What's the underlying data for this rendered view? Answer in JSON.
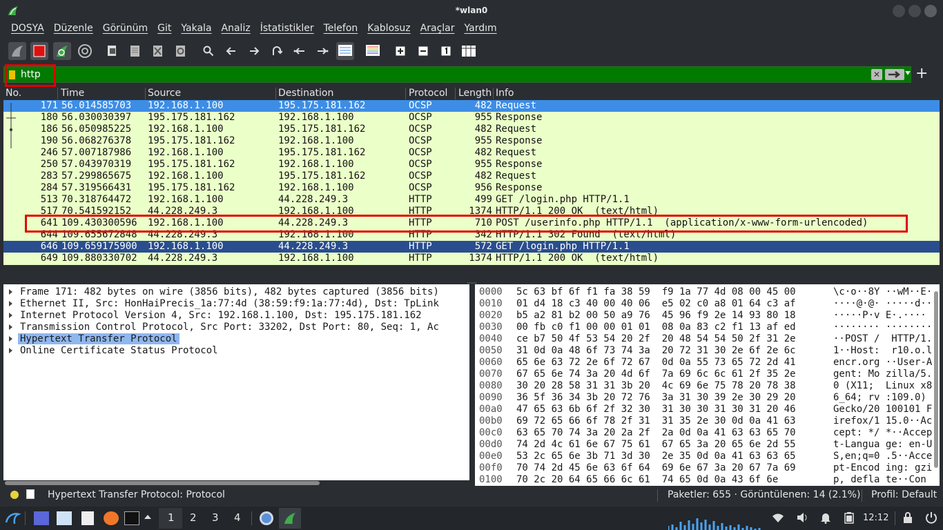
{
  "window": {
    "title": "*wlan0"
  },
  "menu": [
    "DOSYA",
    "Düzenle",
    "Görünüm",
    "Git",
    "Yakala",
    "Analiz",
    "İstatistikler",
    "Telefon",
    "Kablosuz",
    "Araçlar",
    "Yardım"
  ],
  "filter": {
    "value": "http"
  },
  "columns": [
    "No.",
    "Time",
    "Source",
    "Destination",
    "Protocol",
    "Length",
    "Info"
  ],
  "packets": [
    {
      "no": "171",
      "time": "56.014585703",
      "src": "192.168.1.100",
      "dst": "195.175.181.162",
      "proto": "OCSP",
      "len": "482",
      "info": "Request"
    },
    {
      "no": "180",
      "time": "56.030030397",
      "src": "195.175.181.162",
      "dst": "192.168.1.100",
      "proto": "OCSP",
      "len": "955",
      "info": "Response"
    },
    {
      "no": "186",
      "time": "56.050985225",
      "src": "192.168.1.100",
      "dst": "195.175.181.162",
      "proto": "OCSP",
      "len": "482",
      "info": "Request"
    },
    {
      "no": "190",
      "time": "56.068276378",
      "src": "195.175.181.162",
      "dst": "192.168.1.100",
      "proto": "OCSP",
      "len": "955",
      "info": "Response"
    },
    {
      "no": "246",
      "time": "57.007187986",
      "src": "192.168.1.100",
      "dst": "195.175.181.162",
      "proto": "OCSP",
      "len": "482",
      "info": "Request"
    },
    {
      "no": "250",
      "time": "57.043970319",
      "src": "195.175.181.162",
      "dst": "192.168.1.100",
      "proto": "OCSP",
      "len": "955",
      "info": "Response"
    },
    {
      "no": "283",
      "time": "57.299865675",
      "src": "192.168.1.100",
      "dst": "195.175.181.162",
      "proto": "OCSP",
      "len": "482",
      "info": "Request"
    },
    {
      "no": "284",
      "time": "57.319566431",
      "src": "195.175.181.162",
      "dst": "192.168.1.100",
      "proto": "OCSP",
      "len": "956",
      "info": "Response"
    },
    {
      "no": "513",
      "time": "70.318764472",
      "src": "192.168.1.100",
      "dst": "44.228.249.3",
      "proto": "HTTP",
      "len": "499",
      "info": "GET /login.php HTTP/1.1"
    },
    {
      "no": "517",
      "time": "70.541592152",
      "src": "44.228.249.3",
      "dst": "192.168.1.100",
      "proto": "HTTP",
      "len": "1374",
      "info": "HTTP/1.1 200 OK  (text/html)"
    },
    {
      "no": "641",
      "time": "109.430300596",
      "src": "192.168.1.100",
      "dst": "44.228.249.3",
      "proto": "HTTP",
      "len": "710",
      "info": "POST /userinfo.php HTTP/1.1  (application/x-www-form-urlencoded)"
    },
    {
      "no": "644",
      "time": "109.655672848",
      "src": "44.228.249.3",
      "dst": "192.168.1.100",
      "proto": "HTTP",
      "len": "342",
      "info": "HTTP/1.1 302 Found  (text/html)"
    },
    {
      "no": "646",
      "time": "109.659175900",
      "src": "192.168.1.100",
      "dst": "44.228.249.3",
      "proto": "HTTP",
      "len": "572",
      "info": "GET /login.php HTTP/1.1"
    },
    {
      "no": "649",
      "time": "109.880330702",
      "src": "44.228.249.3",
      "dst": "192.168.1.100",
      "proto": "HTTP",
      "len": "1374",
      "info": "HTTP/1.1 200 OK  (text/html)"
    }
  ],
  "details": [
    "Frame 171: 482 bytes on wire (3856 bits), 482 bytes captured (3856 bits)",
    "Ethernet II, Src: HonHaiPrecis_1a:77:4d (38:59:f9:1a:77:4d), Dst: TpLink",
    "Internet Protocol Version 4, Src: 192.168.1.100, Dst: 195.175.181.162",
    "Transmission Control Protocol, Src Port: 33202, Dst Port: 80, Seq: 1, Ac",
    "Hypertext Transfer Protocol",
    "Online Certificate Status Protocol"
  ],
  "bytes": [
    {
      "off": "0000",
      "hex": "5c 63 bf 6f f1 fa 38 59  f9 1a 77 4d 08 00 45 00",
      "asc": "\\c·o··8Y ··wM··E·"
    },
    {
      "off": "0010",
      "hex": "01 d4 18 c3 40 00 40 06  e5 02 c0 a8 01 64 c3 af",
      "asc": "····@·@· ·····d··"
    },
    {
      "off": "0020",
      "hex": "b5 a2 81 b2 00 50 a9 76  45 96 f9 2e 14 93 80 18",
      "asc": "·····P·v E·.····"
    },
    {
      "off": "0030",
      "hex": "00 fb c0 f1 00 00 01 01  08 0a 83 c2 f1 13 af ed",
      "asc": "········ ········"
    },
    {
      "off": "0040",
      "hex": "ce b7 50 4f 53 54 20 2f  20 48 54 54 50 2f 31 2e",
      "asc": "··POST /  HTTP/1."
    },
    {
      "off": "0050",
      "hex": "31 0d 0a 48 6f 73 74 3a  20 72 31 30 2e 6f 2e 6c",
      "asc": "1··Host:  r10.o.l"
    },
    {
      "off": "0060",
      "hex": "65 6e 63 72 2e 6f 72 67  0d 0a 55 73 65 72 2d 41",
      "asc": "encr.org ··User-A"
    },
    {
      "off": "0070",
      "hex": "67 65 6e 74 3a 20 4d 6f  7a 69 6c 6c 61 2f 35 2e",
      "asc": "gent: Mo zilla/5."
    },
    {
      "off": "0080",
      "hex": "30 20 28 58 31 31 3b 20  4c 69 6e 75 78 20 78 38",
      "asc": "0 (X11;  Linux x8"
    },
    {
      "off": "0090",
      "hex": "36 5f 36 34 3b 20 72 76  3a 31 30 39 2e 30 29 20",
      "asc": "6_64; rv :109.0) "
    },
    {
      "off": "00a0",
      "hex": "47 65 63 6b 6f 2f 32 30  31 30 30 31 30 31 20 46",
      "asc": "Gecko/20 100101 F"
    },
    {
      "off": "00b0",
      "hex": "69 72 65 66 6f 78 2f 31  31 35 2e 30 0d 0a 41 63",
      "asc": "irefox/1 15.0··Ac"
    },
    {
      "off": "00c0",
      "hex": "63 65 70 74 3a 20 2a 2f  2a 0d 0a 41 63 63 65 70",
      "asc": "cept: */ *··Accep"
    },
    {
      "off": "00d0",
      "hex": "74 2d 4c 61 6e 67 75 61  67 65 3a 20 65 6e 2d 55",
      "asc": "t-Langua ge: en-U"
    },
    {
      "off": "00e0",
      "hex": "53 2c 65 6e 3b 71 3d 30  2e 35 0d 0a 41 63 63 65",
      "asc": "S,en;q=0 .5··Acce"
    },
    {
      "off": "00f0",
      "hex": "70 74 2d 45 6e 63 6f 64  69 6e 67 3a 20 67 7a 69",
      "asc": "pt-Encod ing: gzi"
    },
    {
      "off": "0100",
      "hex": "70 2c 20 64 65 66 6c 61  74 65 0d 0a 43 6f 6e",
      "asc": "p, defla te··Con"
    }
  ],
  "status": {
    "message": "Hypertext Transfer Protocol: Protocol",
    "packets": "Paketler: 655 · Görüntülenen: 14 (2.1%)",
    "profile": "Profil: Default"
  },
  "taskbar": {
    "workspaces": [
      "1",
      "2",
      "3",
      "4"
    ],
    "clock": "12:12"
  },
  "colors": {
    "list_bg": "#ebffc9",
    "selected": "#3d8de6",
    "marked": "#2a4d8f",
    "filter_ok": "#017a00",
    "highlight": "#e00000"
  }
}
